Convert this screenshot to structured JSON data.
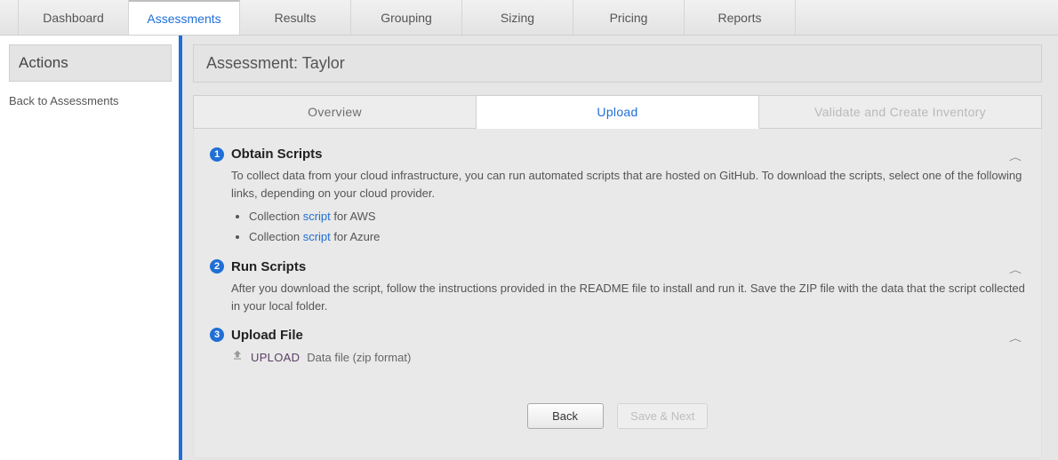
{
  "topnav": {
    "tabs": [
      {
        "label": "Dashboard",
        "active": false
      },
      {
        "label": "Assessments",
        "active": true
      },
      {
        "label": "Results",
        "active": false
      },
      {
        "label": "Grouping",
        "active": false
      },
      {
        "label": "Sizing",
        "active": false
      },
      {
        "label": "Pricing",
        "active": false
      },
      {
        "label": "Reports",
        "active": false
      }
    ]
  },
  "sidebar": {
    "header": "Actions",
    "back": "Back to Assessments"
  },
  "main": {
    "title": "Assessment: Taylor",
    "subtabs": {
      "overview": "Overview",
      "upload": "Upload",
      "validate": "Validate and Create Inventory"
    },
    "steps": {
      "s1": {
        "num": "1",
        "title": "Obtain Scripts",
        "desc": "To collect data from your cloud infrastructure, you can run automated scripts that are hosted on GitHub. To download the scripts, select one of the following links, depending on your cloud provider.",
        "li1_pre": "Collection ",
        "li1_link": "script",
        "li1_post": " for AWS",
        "li2_pre": "Collection ",
        "li2_link": "script",
        "li2_post": " for Azure"
      },
      "s2": {
        "num": "2",
        "title": "Run Scripts",
        "desc": "After you download the script, follow the instructions provided in the README file to install and run it. Save the ZIP file with the data that the script collected in your local folder."
      },
      "s3": {
        "num": "3",
        "title": "Upload File",
        "upload_label": "UPLOAD",
        "upload_hint": "Data file (zip format)"
      }
    },
    "buttons": {
      "back": "Back",
      "save_next": "Save & Next"
    }
  }
}
